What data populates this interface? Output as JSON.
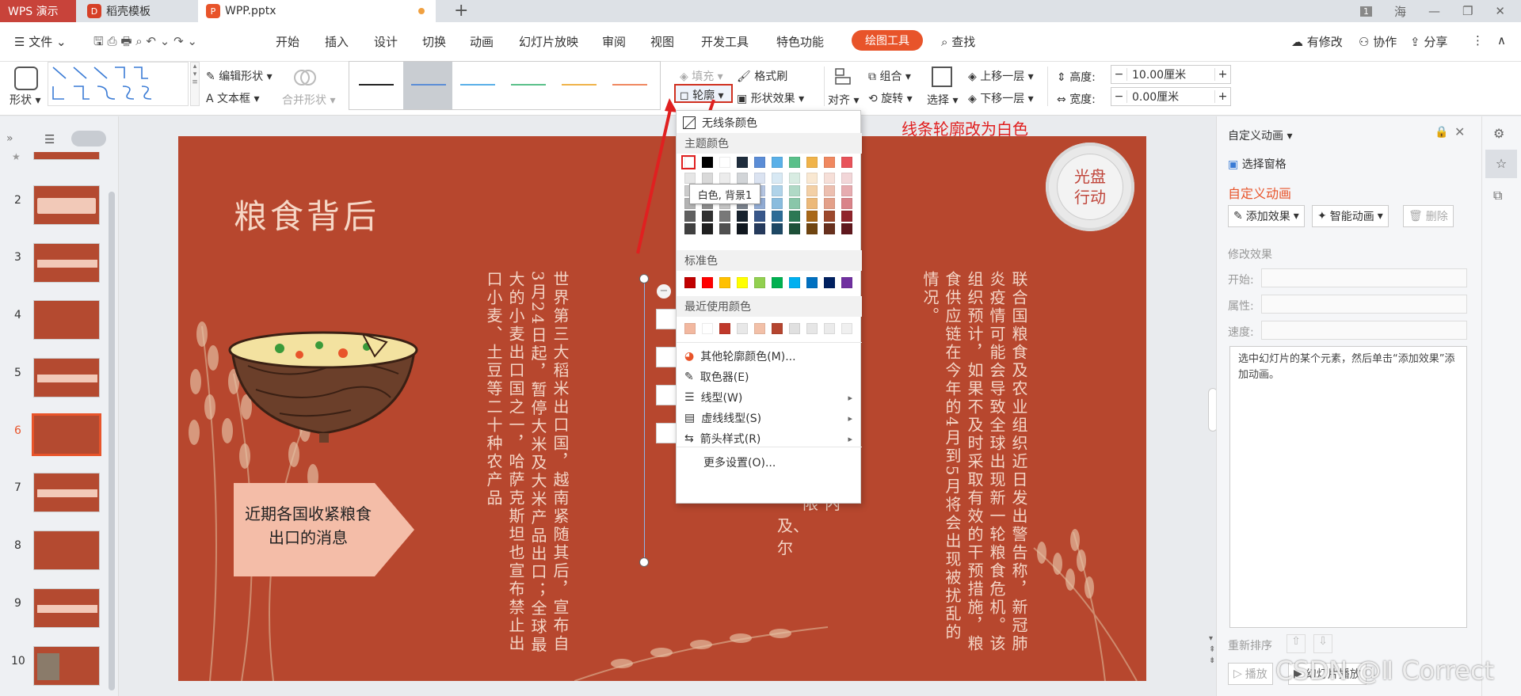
{
  "titlebar": {
    "app_tab": "WPS 演示",
    "doc_tab": "稻壳模板",
    "ppt_tab": "WPP.pptx",
    "badge": "1",
    "user": "海"
  },
  "menu": {
    "file": "文件",
    "items": [
      "开始",
      "插入",
      "设计",
      "切换",
      "动画",
      "幻灯片放映",
      "审阅",
      "视图",
      "开发工具",
      "特色功能"
    ],
    "active": "绘图工具",
    "search": "查找",
    "right": [
      "有修改",
      "协作",
      "分享"
    ]
  },
  "ribbon": {
    "shape_label": "形状",
    "edit_shape": "编辑形状",
    "text_box": "文本框",
    "merge_shape": "合并形状",
    "fill": "填充",
    "format_painter": "格式刷",
    "outline": "轮廓",
    "shape_effect": "形状效果",
    "align": "对齐",
    "group": "组合",
    "rotate": "旋转",
    "select": "选择",
    "bring_forward": "上移一层",
    "send_backward": "下移一层",
    "height_label": "高度:",
    "height_value": "10.00厘米",
    "width_label": "宽度:",
    "width_value": "0.00厘米"
  },
  "slides": {
    "numbers": [
      "2",
      "3",
      "4",
      "5",
      "6",
      "7",
      "8",
      "9",
      "10"
    ],
    "current": "6"
  },
  "slide": {
    "title": "粮食背后",
    "badge": "光盘\n行动",
    "badge_line1": "光盘",
    "badge_line2": "行动",
    "arrow_text": "近期各国收紧粮食出口的消息",
    "col1": "联合国粮食及农业组织近日发出警告称，新冠肺炎疫情可能会导致全球出现新一轮粮食危机。该组织预计，如果不及时采取有效的干预措施，粮食供应链在今年的4月到5月将会出现被扰乱的情况。",
    "col2": "世界第三大稻米出口国，越南紧随其后，宣布自3月24日起，暂停大米及大米产品出口；全球最大的小麦出口国之一，哈萨克斯坦也宣布禁止出口小麦、土豆等二十种农产品",
    "col3_fragments": [
      "内",
      "限",
      "及、",
      "尔"
    ]
  },
  "annotation": "线条轮廓改为白色",
  "dropdown": {
    "no_line": "无线条颜色",
    "theme_colors": "主题颜色",
    "tooltip": "白色, 背景1",
    "standard_colors": "标准色",
    "recent_colors": "最近使用颜色",
    "other_colors": "其他轮廓颜色(M)...",
    "eyedropper": "取色器(E)",
    "line_type": "线型(W)",
    "dash_type": "虚线线型(S)",
    "arrow_style": "箭头样式(R)",
    "more_settings": "更多设置(O)...",
    "theme_top_row": [
      "#ffffff",
      "#000000",
      "#ffffff",
      "#1f2d3d",
      "#5b8dd6",
      "#5ab0e8",
      "#5ac08a",
      "#f0b34a",
      "#f08860",
      "#e8535a"
    ],
    "standard_row": [
      "#c00000",
      "#ff0000",
      "#ffc000",
      "#ffff00",
      "#92d050",
      "#00b050",
      "#00b0f0",
      "#0070c0",
      "#002060",
      "#7030a0"
    ],
    "recent_row": [
      "#f2b8a0",
      "#ffffff",
      "#c0392b",
      "#e8e8e8",
      "#f2c0a8",
      "#b5452f",
      "#e0e0e0",
      "#e6e6e6",
      "#ebebeb",
      "#f0f0f0"
    ]
  },
  "rightpanel": {
    "title": "自定义动画",
    "select_pane": "选择窗格",
    "section_title": "自定义动画",
    "add_effect": "添加效果",
    "smart_anim": "智能动画",
    "delete": "删除",
    "modify": "修改效果",
    "start": "开始:",
    "property": "属性:",
    "speed": "速度:",
    "hint": "选中幻灯片的某个元素，然后单击“添加效果”添加动画。",
    "reorder": "重新排序",
    "play": "播放",
    "slideshow": "幻灯片播放"
  },
  "watermark": "CSDN @Ⅱ Correct"
}
